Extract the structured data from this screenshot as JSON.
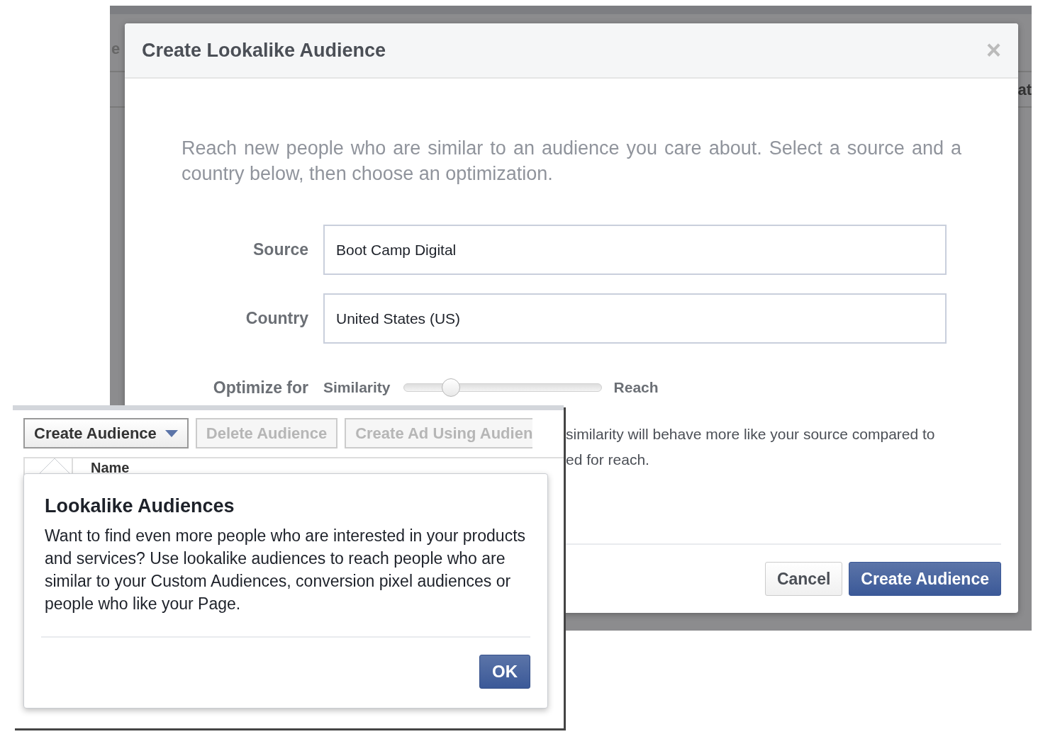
{
  "background_window": {
    "fragments": [
      "e",
      "at"
    ]
  },
  "dialog": {
    "title": "Create Lookalike Audience",
    "close": "×",
    "intro": "Reach new people who are similar to an audience you care about. Select a source and a country below, then choose an optimization.",
    "fields": [
      {
        "label": "Source",
        "value": "Boot Camp Digital"
      },
      {
        "label": "Country",
        "value": "United States (US)"
      }
    ],
    "optimize": {
      "label": "Optimize for",
      "min_label": "Similarity",
      "max_label": "Reach",
      "level": 0.24
    },
    "note_lines": [
      "similarity will behave more like your source compared to",
      "ed for reach."
    ],
    "buttons": [
      {
        "label": "Cancel",
        "primary": false
      },
      {
        "label": "Create Audience",
        "primary": true
      }
    ]
  },
  "audience_panel": {
    "toolbar": [
      {
        "label": "Create Audience",
        "disabled": false,
        "dropdown": true
      },
      {
        "label": "Delete Audience",
        "disabled": true,
        "dropdown": false
      },
      {
        "label": "Create Ad Using Audien",
        "disabled": true,
        "dropdown": false
      }
    ],
    "table": {
      "columns": [
        "Name"
      ]
    }
  },
  "popover": {
    "title": "Lookalike Audiences",
    "body": "Want to find even more people who are interested in your products and services? Use lookalike audiences to reach people who are similar to your Custom Audiences, conversion pixel audiences or people who like your Page.",
    "button": "OK"
  }
}
